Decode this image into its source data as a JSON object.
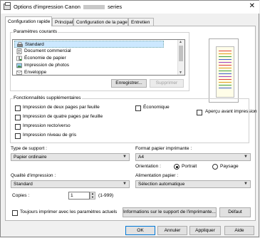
{
  "window": {
    "title_prefix": "Options d'impression Canon",
    "title_suffix": "series",
    "close_glyph": "✕"
  },
  "tabs": [
    {
      "label": "Configuration rapide",
      "active": true
    },
    {
      "label": "Principal"
    },
    {
      "label": "Configuration de la page"
    },
    {
      "label": "Entretien"
    }
  ],
  "profiles": {
    "legend": "Paramètres courants",
    "items": [
      {
        "label": "Standard",
        "icon": "printer-icon",
        "selected": true
      },
      {
        "label": "Document commercial",
        "icon": "document-icon"
      },
      {
        "label": "Économie de papier",
        "icon": "paper-saving-icon"
      },
      {
        "label": "Impression de photos",
        "icon": "photo-icon"
      },
      {
        "label": "Enveloppe",
        "icon": "envelope-icon"
      }
    ],
    "save_label": "Enregistrer...",
    "delete_label": "Supprimer"
  },
  "preview": {
    "checkbox_label": "Aperçu avant impression"
  },
  "features": {
    "legend": "Fonctionnalités supplémentaires",
    "items": [
      "Impression de deux pages par feuille",
      "Impression de quatre pages par feuille",
      "Impression recto/verso",
      "Impression niveau de gris"
    ],
    "economy_label": "Économique"
  },
  "media": {
    "label": "Type de support :",
    "value": "Papier ordinaire"
  },
  "paper_size": {
    "label": "Format papier imprimante :",
    "value": "A4"
  },
  "orientation": {
    "label": "Orientation :",
    "portrait": "Portrait",
    "landscape": "Paysage",
    "selected": "portrait"
  },
  "quality": {
    "label": "Qualité d'impression :",
    "value": "Standard"
  },
  "paper_source": {
    "label": "Alimentation papier :",
    "value": "Sélection automatique"
  },
  "copies": {
    "label": "Copies :",
    "value": "1",
    "range": "(1-999)"
  },
  "bottom": {
    "always_label": "Toujours imprimer avec les paramètres actuels",
    "info_label": "Informations sur le support de l'imprimante...",
    "default_label": "Défaut"
  },
  "dialog": {
    "ok": "OK",
    "cancel": "Annuler",
    "apply": "Appliquer",
    "help": "Aide"
  }
}
